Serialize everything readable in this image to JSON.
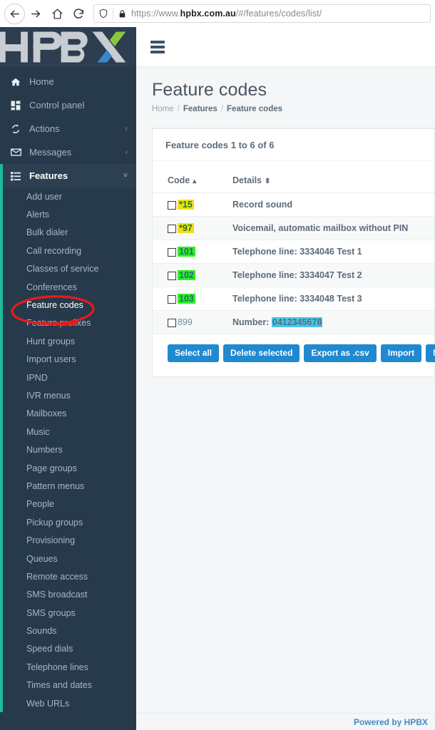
{
  "browser": {
    "nav": {
      "back": "back-arrow",
      "forward": "forward-arrow",
      "home": "home",
      "reload": "reload"
    },
    "shield_icon": "shield-icon",
    "lock_icon": "lock-icon",
    "url_prefix": "https://www.",
    "url_domain": "hpbx.com.au",
    "url_path": "/#/features/codes/list/"
  },
  "brand": {
    "logo_text": "HPBX"
  },
  "sidebar": {
    "top_items": [
      {
        "label": "Home",
        "icon": "home-icon",
        "caret": ""
      },
      {
        "label": "Control panel",
        "icon": "grid-icon",
        "caret": ""
      },
      {
        "label": "Actions",
        "icon": "sync-icon",
        "caret": "‹"
      },
      {
        "label": "Messages",
        "icon": "envelope-icon",
        "caret": "‹"
      },
      {
        "label": "Features",
        "icon": "list-icon",
        "caret": "˅"
      }
    ],
    "sub_items": [
      "Add user",
      "Alerts",
      "Bulk dialer",
      "Call recording",
      "Classes of service",
      "Conferences",
      "Feature codes",
      "Feature prefixes",
      "Hunt groups",
      "Import users",
      "IPND",
      "IVR menus",
      "Mailboxes",
      "Music",
      "Numbers",
      "Page groups",
      "Pattern menus",
      "People",
      "Pickup groups",
      "Provisioning",
      "Queues",
      "Remote access",
      "SMS broadcast",
      "SMS groups",
      "Sounds",
      "Speed dials",
      "Telephone lines",
      "Times and dates",
      "Web URLs"
    ],
    "current_sub": "Feature codes",
    "accent_color": "#1abc9c"
  },
  "topbar": {
    "menu_icon": "hamburger-icon"
  },
  "page": {
    "title": "Feature codes",
    "breadcrumb": [
      "Home",
      "Features",
      "Feature codes"
    ],
    "breadcrumb_separator": "/"
  },
  "panel": {
    "heading": "Feature codes 1 to 6 of 6",
    "columns": [
      {
        "label": "Code",
        "sort": "▴"
      },
      {
        "label": "Details",
        "sort": "⬍"
      }
    ],
    "rows": [
      {
        "code": "*15",
        "highlight": "yellow",
        "details": "Record sound",
        "details_highlight": ""
      },
      {
        "code": "*97",
        "highlight": "yellow",
        "details": "Voicemail, automatic mailbox without PIN",
        "details_highlight": ""
      },
      {
        "code": "101",
        "highlight": "green",
        "details": "Telephone line: 3334046 Test 1",
        "details_highlight": ""
      },
      {
        "code": "102",
        "highlight": "green",
        "details": "Telephone line: 3334047 Test 2",
        "details_highlight": ""
      },
      {
        "code": "103",
        "highlight": "green",
        "details": "Telephone line: 3334048 Test 3",
        "details_highlight": ""
      },
      {
        "code": "899",
        "highlight": "none",
        "details_prefix": "Number: ",
        "details_highlight": "0412345678",
        "details": ""
      }
    ],
    "buttons": [
      "Select all",
      "Delete selected",
      "Export as .csv",
      "Import",
      "New"
    ]
  },
  "highlight_colors": {
    "yellow": "#f2dd1b",
    "green": "#2cf11e",
    "cyan": "#45c6ef",
    "annotation_red": "#e81b1b",
    "button_blue": "#2089cf"
  },
  "footer": {
    "text": "Powered by HPBX"
  }
}
